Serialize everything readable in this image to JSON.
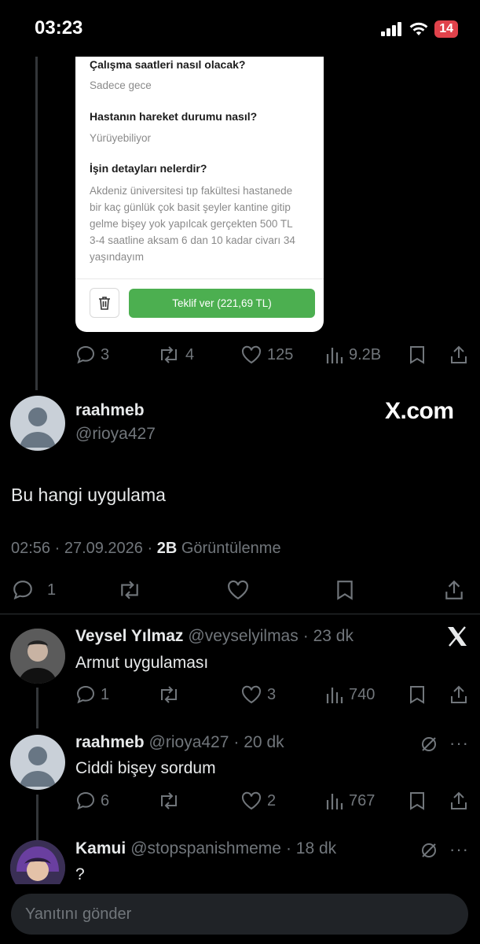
{
  "status": {
    "time": "03:23",
    "battery": "14"
  },
  "quoted_form": {
    "items": [
      {
        "question": "Çalışma saatleri nasıl olacak?",
        "answer": "Sadece gece"
      },
      {
        "question": "Hastanın hareket durumu nasıl?",
        "answer": "Yürüyebiliyor"
      },
      {
        "question": "İşin detayları nelerdir?",
        "answer_lines": [
          "Akdeniz üniversitesi tıp fakültesi hastanede",
          "bir kaç günlük çok basit şeyler kantine gitip",
          "gelme bişey yok yapılcak gerçekten 500 TL",
          "3-4 saatline  aksam 6 dan 10 kadar civarı 34",
          "yaşındayım"
        ]
      }
    ],
    "offer_button": "Teklif ver (221,69 TL)"
  },
  "first_tweet_actions": {
    "replies": "3",
    "retweets": "4",
    "likes": "125",
    "views": "9.2B"
  },
  "main_tweet": {
    "name": "raahmeb",
    "handle": "@rioya427",
    "watermark": "X.com",
    "text": "Bu hangi uygulama",
    "time": "02:56 · 27.09.2026 ·",
    "views_count": "2B",
    "views_label": "Görüntülenme",
    "replies": "1"
  },
  "replies": [
    {
      "name": "Veysel Yılmaz",
      "handle": "@veyselyilmas",
      "age": "· 23 dk",
      "text": "Armut uygulaması",
      "replies": "1",
      "likes": "3",
      "views": "740"
    },
    {
      "name": "raahmeb",
      "handle": "@rioya427",
      "age": "· 20 dk",
      "text": "Ciddi bişey sordum",
      "replies": "6",
      "likes": "2",
      "views": "767"
    },
    {
      "name": "Kamui",
      "handle": "@stopspanishmeme",
      "age": "· 18 dk",
      "text": "?"
    }
  ],
  "compose": {
    "placeholder": "Yanıtını gönder"
  }
}
